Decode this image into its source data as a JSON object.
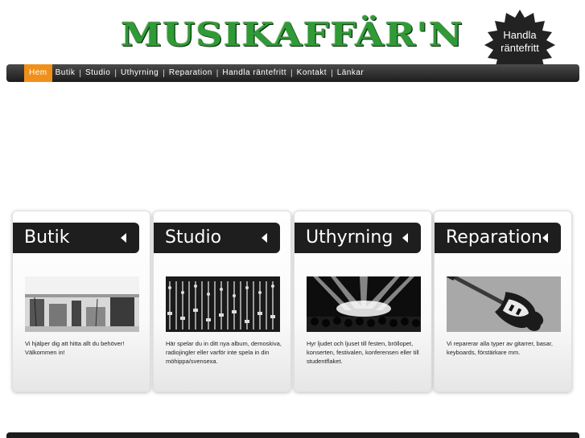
{
  "header": {
    "logo_text": "MUSIKAFFÄR'N",
    "badge": {
      "line1": "Handla",
      "line2": "räntefritt"
    }
  },
  "nav": {
    "items": [
      {
        "label": "Hem",
        "active": true
      },
      {
        "label": "Butik"
      },
      {
        "label": "Studio"
      },
      {
        "label": "Uthyrning"
      },
      {
        "label": "Reparation"
      },
      {
        "label": "Handla räntefritt"
      },
      {
        "label": "Kontakt"
      },
      {
        "label": "Länkar"
      }
    ],
    "separator": "|"
  },
  "cards": [
    {
      "title": "Butik",
      "image": "music-store-photo",
      "text": "Vi hjälper dig att hitta allt du behöver! Välkommen in!"
    },
    {
      "title": "Studio",
      "image": "mixing-console-photo",
      "text": "Här spelar du in ditt nya album, demoskiva, radiojingler eller varför inte spela in din möhippa/svensexa."
    },
    {
      "title": "Uthyrning",
      "image": "concert-stage-photo",
      "text": "Hyr ljudet och ljuset till festen, bröllopet, konserten, festivalen, konferensen eller till studentflaket."
    },
    {
      "title": "Reparation",
      "image": "electric-guitar-photo",
      "text": "Vi reparerar alla typer av gitarrer, basar, keyboards, förstärkare mm."
    }
  ],
  "colors": {
    "nav_bg": "#1c1c1c",
    "nav_active": "#f0901a",
    "logo_green": "#2f9a36",
    "card_head": "#1e1e1e"
  }
}
